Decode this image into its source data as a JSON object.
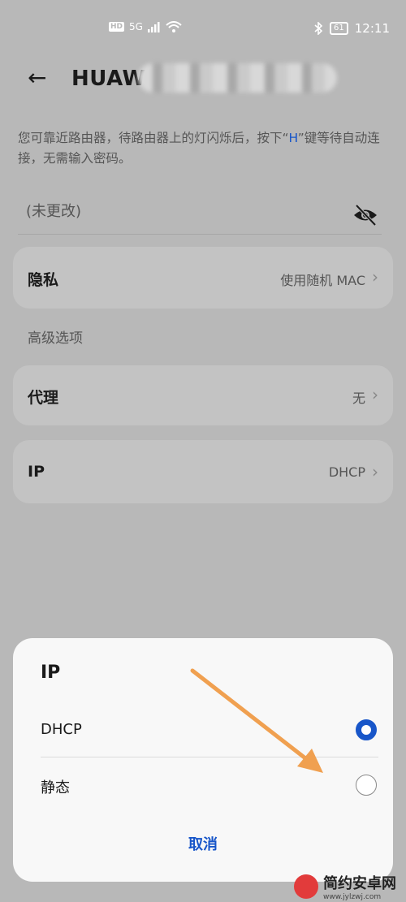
{
  "status_bar": {
    "hd_badge": "HD",
    "signal": "5G",
    "battery": "61",
    "time": "12:11"
  },
  "header": {
    "title": "HUAW"
  },
  "hint": {
    "before": "您可靠近路由器，待路由器上的灯闪烁后，按下“",
    "key": "H",
    "after": "”键等待自动连接，无需输入密码。"
  },
  "password": {
    "value": "(未更改)"
  },
  "privacy": {
    "label": "隐私",
    "value": "使用随机 MAC"
  },
  "advanced_label": "高级选项",
  "proxy": {
    "label": "代理",
    "value": "无"
  },
  "ip": {
    "label": "IP",
    "value": "DHCP"
  },
  "dialog": {
    "title": "IP",
    "options": [
      {
        "label": "DHCP",
        "selected": true
      },
      {
        "label": "静态",
        "selected": false
      }
    ],
    "cancel_label": "取消"
  },
  "watermark": {
    "text": "简约安卓网",
    "sub": "www.jylzwj.com"
  },
  "colors": {
    "accent": "#1856c9",
    "arrow": "#f0a050"
  }
}
